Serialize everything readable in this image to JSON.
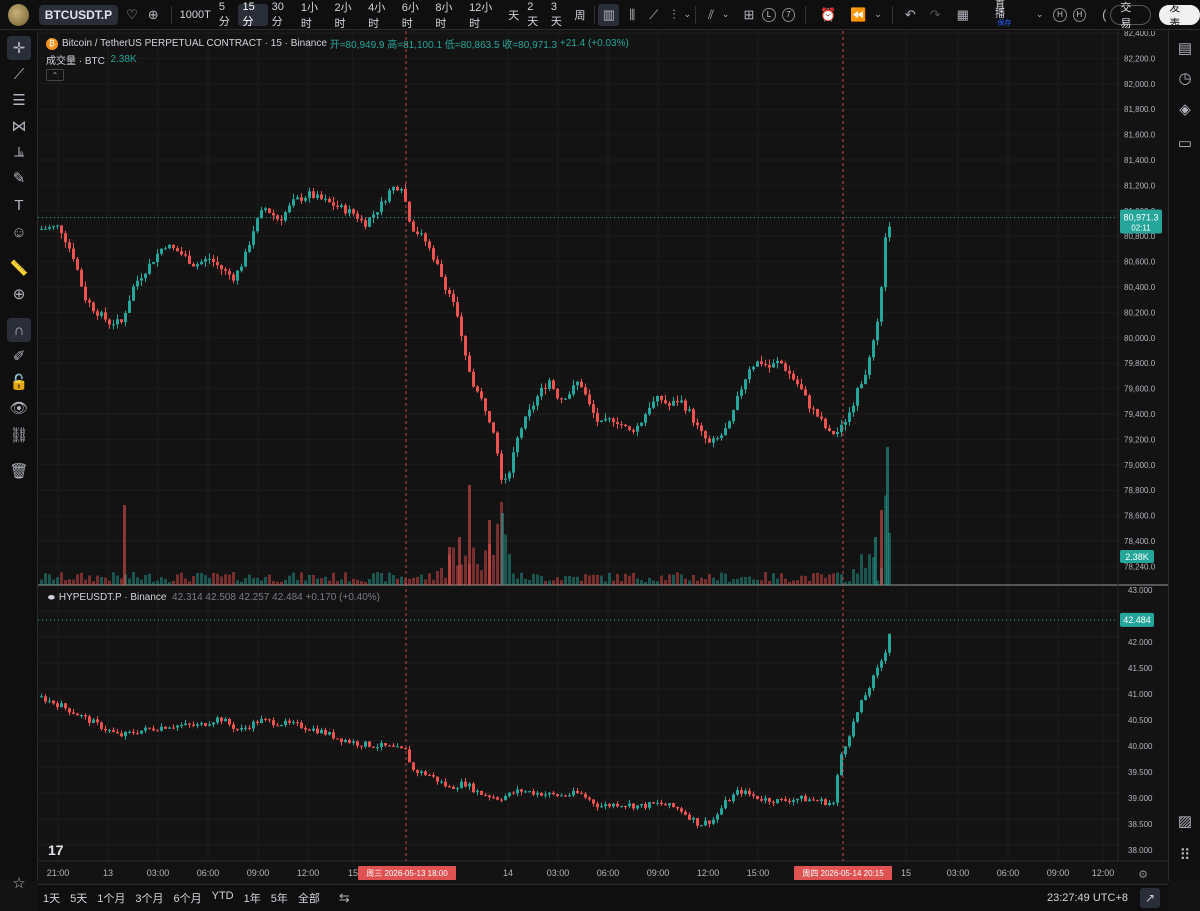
{
  "topbar": {
    "symbol": "BTCUSDT.P",
    "intervals": [
      "1000T",
      "5分",
      "15分",
      "30分",
      "1小时",
      "2小时",
      "4小时",
      "6小时",
      "8小时",
      "12小时",
      "天",
      "2天",
      "3天",
      "周"
    ],
    "active_interval": "15分",
    "badge_l": "L",
    "badge_7": "7",
    "live_label": "直播",
    "live_sub": "保存",
    "badge_h1": "H",
    "badge_h2": "H",
    "trade_btn": "交易",
    "publish_btn": "发表"
  },
  "main_legend": {
    "title": "Bitcoin / TetherUS PERPETUAL CONTRACT · 15 · Binance",
    "open": "开=80,949.9",
    "high": "高=81,100.1",
    "low": "低=80,863.5",
    "close": "收=80,971.3",
    "change": "+21.4 (+0.03%)",
    "volume_label": "成交量 · BTC",
    "volume_value": "2.38K"
  },
  "sub_legend": {
    "title": "HYPEUSDT.P · Binance",
    "values": "42.314  42.508  42.257  42.484  +0.170 (+0.40%)"
  },
  "price_axis_main": [
    "82,400.0",
    "82,200.0",
    "82,000.0",
    "81,800.0",
    "81,600.0",
    "81,400.0",
    "81,200.0",
    "81,000.0",
    "80,800.0",
    "80,600.0",
    "80,400.0",
    "80,200.0",
    "80,000.0",
    "79,800.0",
    "79,600.0",
    "79,400.0",
    "79,200.0",
    "79,000.0",
    "78,800.0",
    "78,600.0",
    "78,400.0",
    "78,240.0"
  ],
  "price_axis_sub": [
    "43.000",
    "42.500",
    "42.000",
    "41.500",
    "41.000",
    "40.500",
    "40.000",
    "39.500",
    "39.000",
    "38.500",
    "38.000"
  ],
  "last_price_main": "80,971.3",
  "countdown": "02:11",
  "volume_tag": "2.38K",
  "last_price_sub": "42.484",
  "time_axis": [
    "21:00",
    "13",
    "03:00",
    "06:00",
    "09:00",
    "12:00",
    "15",
    "14",
    "03:00",
    "06:00",
    "09:00",
    "12:00",
    "15:00",
    "15",
    "03:00",
    "06:00",
    "09:00",
    "12:00"
  ],
  "crosshair_label_1": "周三 2026-05-13   18:00",
  "crosshair_label_2": "周四 2026-05-14   20:15",
  "bottombar": {
    "ranges": [
      "1天",
      "5天",
      "1个月",
      "3个月",
      "6个月",
      "YTD",
      "1年",
      "5年",
      "全部"
    ],
    "clock": "23:27:49 UTC+8"
  },
  "colors": {
    "up": "#26a69a",
    "down": "#ef5350",
    "bg": "#131313",
    "grid": "#1f1f1f",
    "accent_label": "#e05252"
  }
}
